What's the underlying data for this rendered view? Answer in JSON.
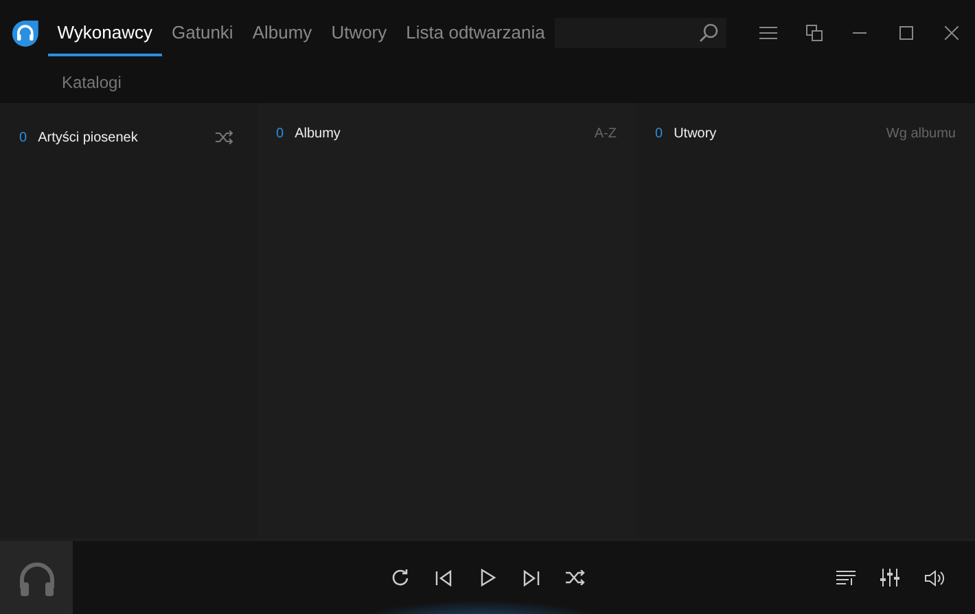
{
  "tabs": [
    {
      "label": "Wykonawcy",
      "selected": true
    },
    {
      "label": "Gatunki",
      "selected": false
    },
    {
      "label": "Albumy",
      "selected": false
    },
    {
      "label": "Utwory",
      "selected": false
    },
    {
      "label": "Lista odtwarzania",
      "selected": false
    }
  ],
  "subtabs": [
    {
      "label": "Katalogi",
      "selected": false
    }
  ],
  "panels": [
    {
      "count": "0",
      "title": "Artyści piosenek",
      "kind": "shuffle"
    },
    {
      "count": "0",
      "title": "Albumy",
      "kind": "sort",
      "sort": "A-Z"
    },
    {
      "count": "0",
      "title": "Utwory",
      "kind": "sort",
      "sort": "Wg albumu"
    }
  ]
}
